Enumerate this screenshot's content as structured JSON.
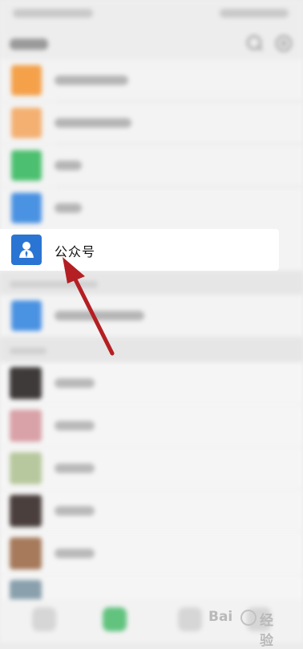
{
  "highlighted_row": {
    "label": "公众号",
    "icon": "person-icon"
  },
  "annotation": {
    "arrow_color": "#b41f23"
  },
  "watermark": {
    "text_left": "Bai",
    "text_right": "经验"
  },
  "colors": {
    "accent_blue": "#2a75d3",
    "orange": "#f4a14a",
    "green": "#4cc070",
    "blue": "#4a92e2"
  }
}
